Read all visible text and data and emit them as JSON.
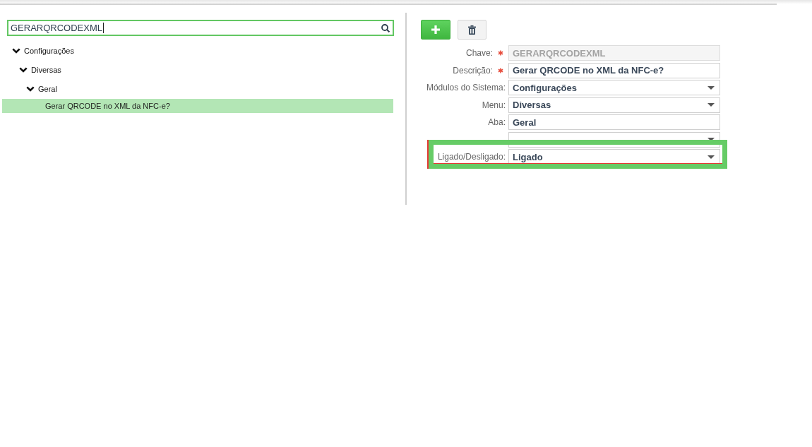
{
  "search": {
    "value": "GERARQRCODEXML"
  },
  "tree": [
    {
      "label": "Configurações",
      "expanded": true,
      "selected": false,
      "children": [
        {
          "label": "Diversas",
          "expanded": true,
          "selected": false,
          "children": [
            {
              "label": "Geral",
              "expanded": true,
              "selected": false,
              "children": [
                {
                  "label": "Gerar QRCODE no XML da NFC-e?",
                  "selected": true
                }
              ]
            }
          ]
        }
      ]
    }
  ],
  "toolbar": [
    {
      "kind": "add"
    },
    {
      "kind": "delete"
    }
  ],
  "form": [
    {
      "kind": "text",
      "label": "Chave:",
      "required": true,
      "disabled": true,
      "highlighted": false,
      "value": "GERARQRCODEXML"
    },
    {
      "kind": "text",
      "label": "Descrição:",
      "required": true,
      "disabled": false,
      "highlighted": false,
      "value": "Gerar QRCODE no XML da NFC-e?"
    },
    {
      "kind": "select",
      "label": "Módulos do Sistema:",
      "required": false,
      "disabled": false,
      "highlighted": false,
      "value": "Configurações"
    },
    {
      "kind": "select",
      "label": "Menu:",
      "required": false,
      "disabled": false,
      "highlighted": false,
      "value": "Diversas"
    },
    {
      "kind": "text",
      "label": "Aba:",
      "required": false,
      "disabled": false,
      "highlighted": false,
      "value": "Geral"
    },
    {
      "kind": "select",
      "required": false,
      "disabled": false,
      "highlighted": false
    },
    {
      "kind": "select",
      "label": "Ligado/Desligado:",
      "required": false,
      "disabled": false,
      "highlighted": true,
      "value": "Ligado"
    }
  ]
}
